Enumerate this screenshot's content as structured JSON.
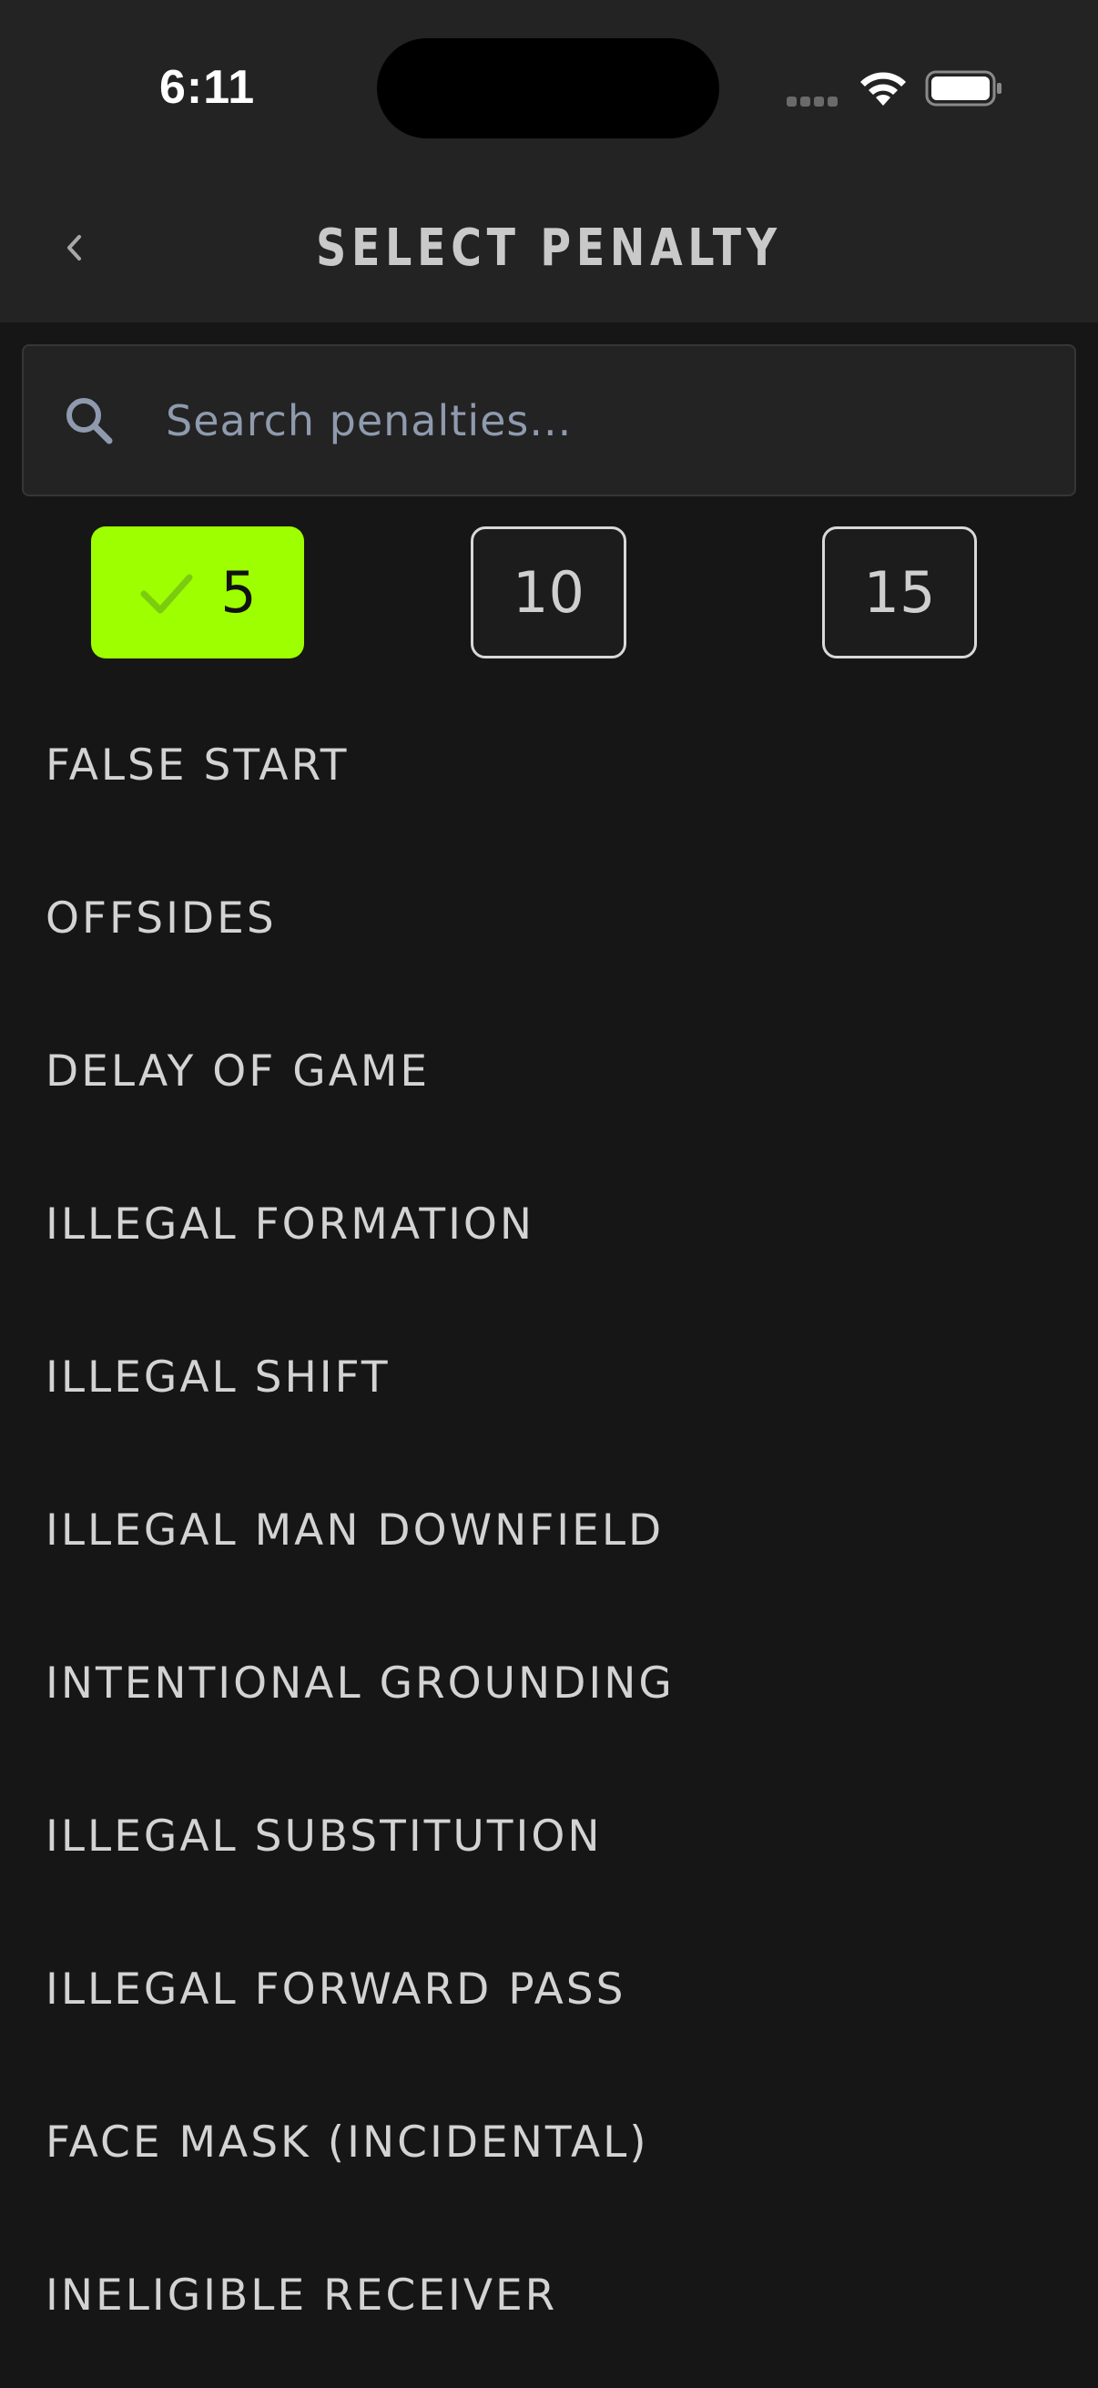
{
  "status_bar": {
    "time": "6:11"
  },
  "header": {
    "title": "SELECT PENALTY",
    "back_icon": "chevron-left-icon"
  },
  "search": {
    "placeholder": "Search penalties...",
    "value": "",
    "icon": "search-icon"
  },
  "yardage_filters": [
    {
      "label": "5",
      "selected": true
    },
    {
      "label": "10",
      "selected": false
    },
    {
      "label": "15",
      "selected": false
    }
  ],
  "penalties": [
    "FALSE START",
    "OFFSIDES",
    "DELAY OF GAME",
    "ILLEGAL FORMATION",
    "ILLEGAL SHIFT",
    "ILLEGAL MAN DOWNFIELD",
    "INTENTIONAL GROUNDING",
    "ILLEGAL SUBSTITUTION",
    "ILLEGAL FORWARD PASS",
    "FACE MASK (INCIDENTAL)",
    "INELIGIBLE RECEIVER"
  ],
  "colors": {
    "background": "#161616",
    "header": "#232323",
    "accent": "#9dff00",
    "text": "#d3d3d3",
    "placeholder": "#8f9aae"
  }
}
